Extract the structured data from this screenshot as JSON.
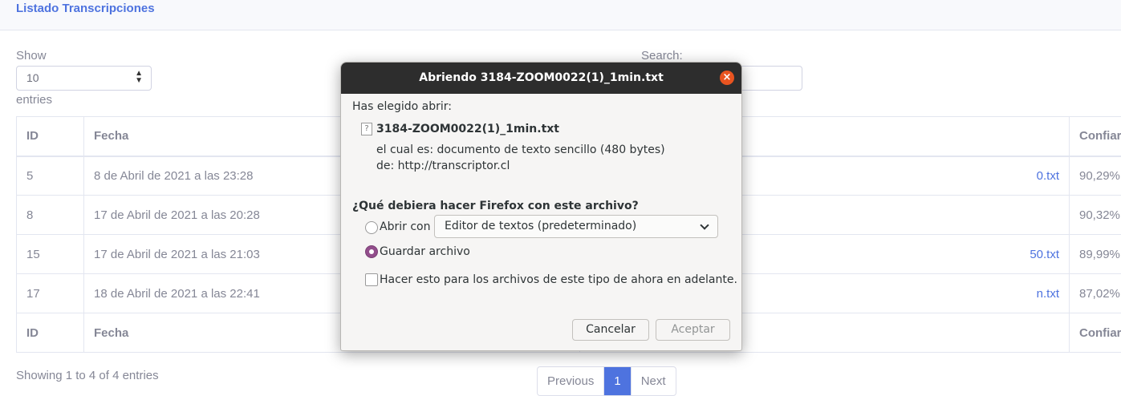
{
  "header": {
    "title": "Listado Transcripciones"
  },
  "controls": {
    "show_label": "Show",
    "length_value": "10",
    "entries_label": "entries",
    "search_label": "Search:"
  },
  "table": {
    "columns": [
      "ID",
      "Fecha",
      "Confiar"
    ],
    "rows": [
      {
        "id": "5",
        "fecha": "8 de Abril de 2021 a las 23:28",
        "file": "0.txt",
        "conf": "90,29%"
      },
      {
        "id": "8",
        "fecha": "17 de Abril de 2021 a las 20:28",
        "file": "",
        "conf": "90,32%"
      },
      {
        "id": "15",
        "fecha": "17 de Abril de 2021 a las 21:03",
        "file": "50.txt",
        "conf": "89,99%"
      },
      {
        "id": "17",
        "fecha": "18 de Abril de 2021 a las 22:41",
        "file": "n.txt",
        "conf": "87,02%"
      }
    ]
  },
  "footer": {
    "info": "Showing 1 to 4 of 4 entries",
    "previous": "Previous",
    "current_page": "1",
    "next": "Next"
  },
  "dialog": {
    "title": "Abriendo 3184-ZOOM0022(1)_1min.txt",
    "intro": "Has elegido abrir:",
    "filename": "3184-ZOOM0022(1)_1min.txt",
    "type_line": "el cual es:  documento de texto sencillo (480 bytes)",
    "from_line": "de:  http://transcriptor.cl",
    "question": "¿Qué debiera hacer Firefox con este archivo?",
    "open_with_label": "Abrir con",
    "open_with_app": "Editor de textos (predeterminado)",
    "save_label": "Guardar archivo",
    "save_selected": true,
    "remember_label": "Hacer esto para los archivos de este tipo de ahora en adelante.",
    "cancel_label": "Cancelar",
    "accept_label": "Aceptar",
    "accent_color": "#924d8b",
    "close_color": "#e95420"
  }
}
